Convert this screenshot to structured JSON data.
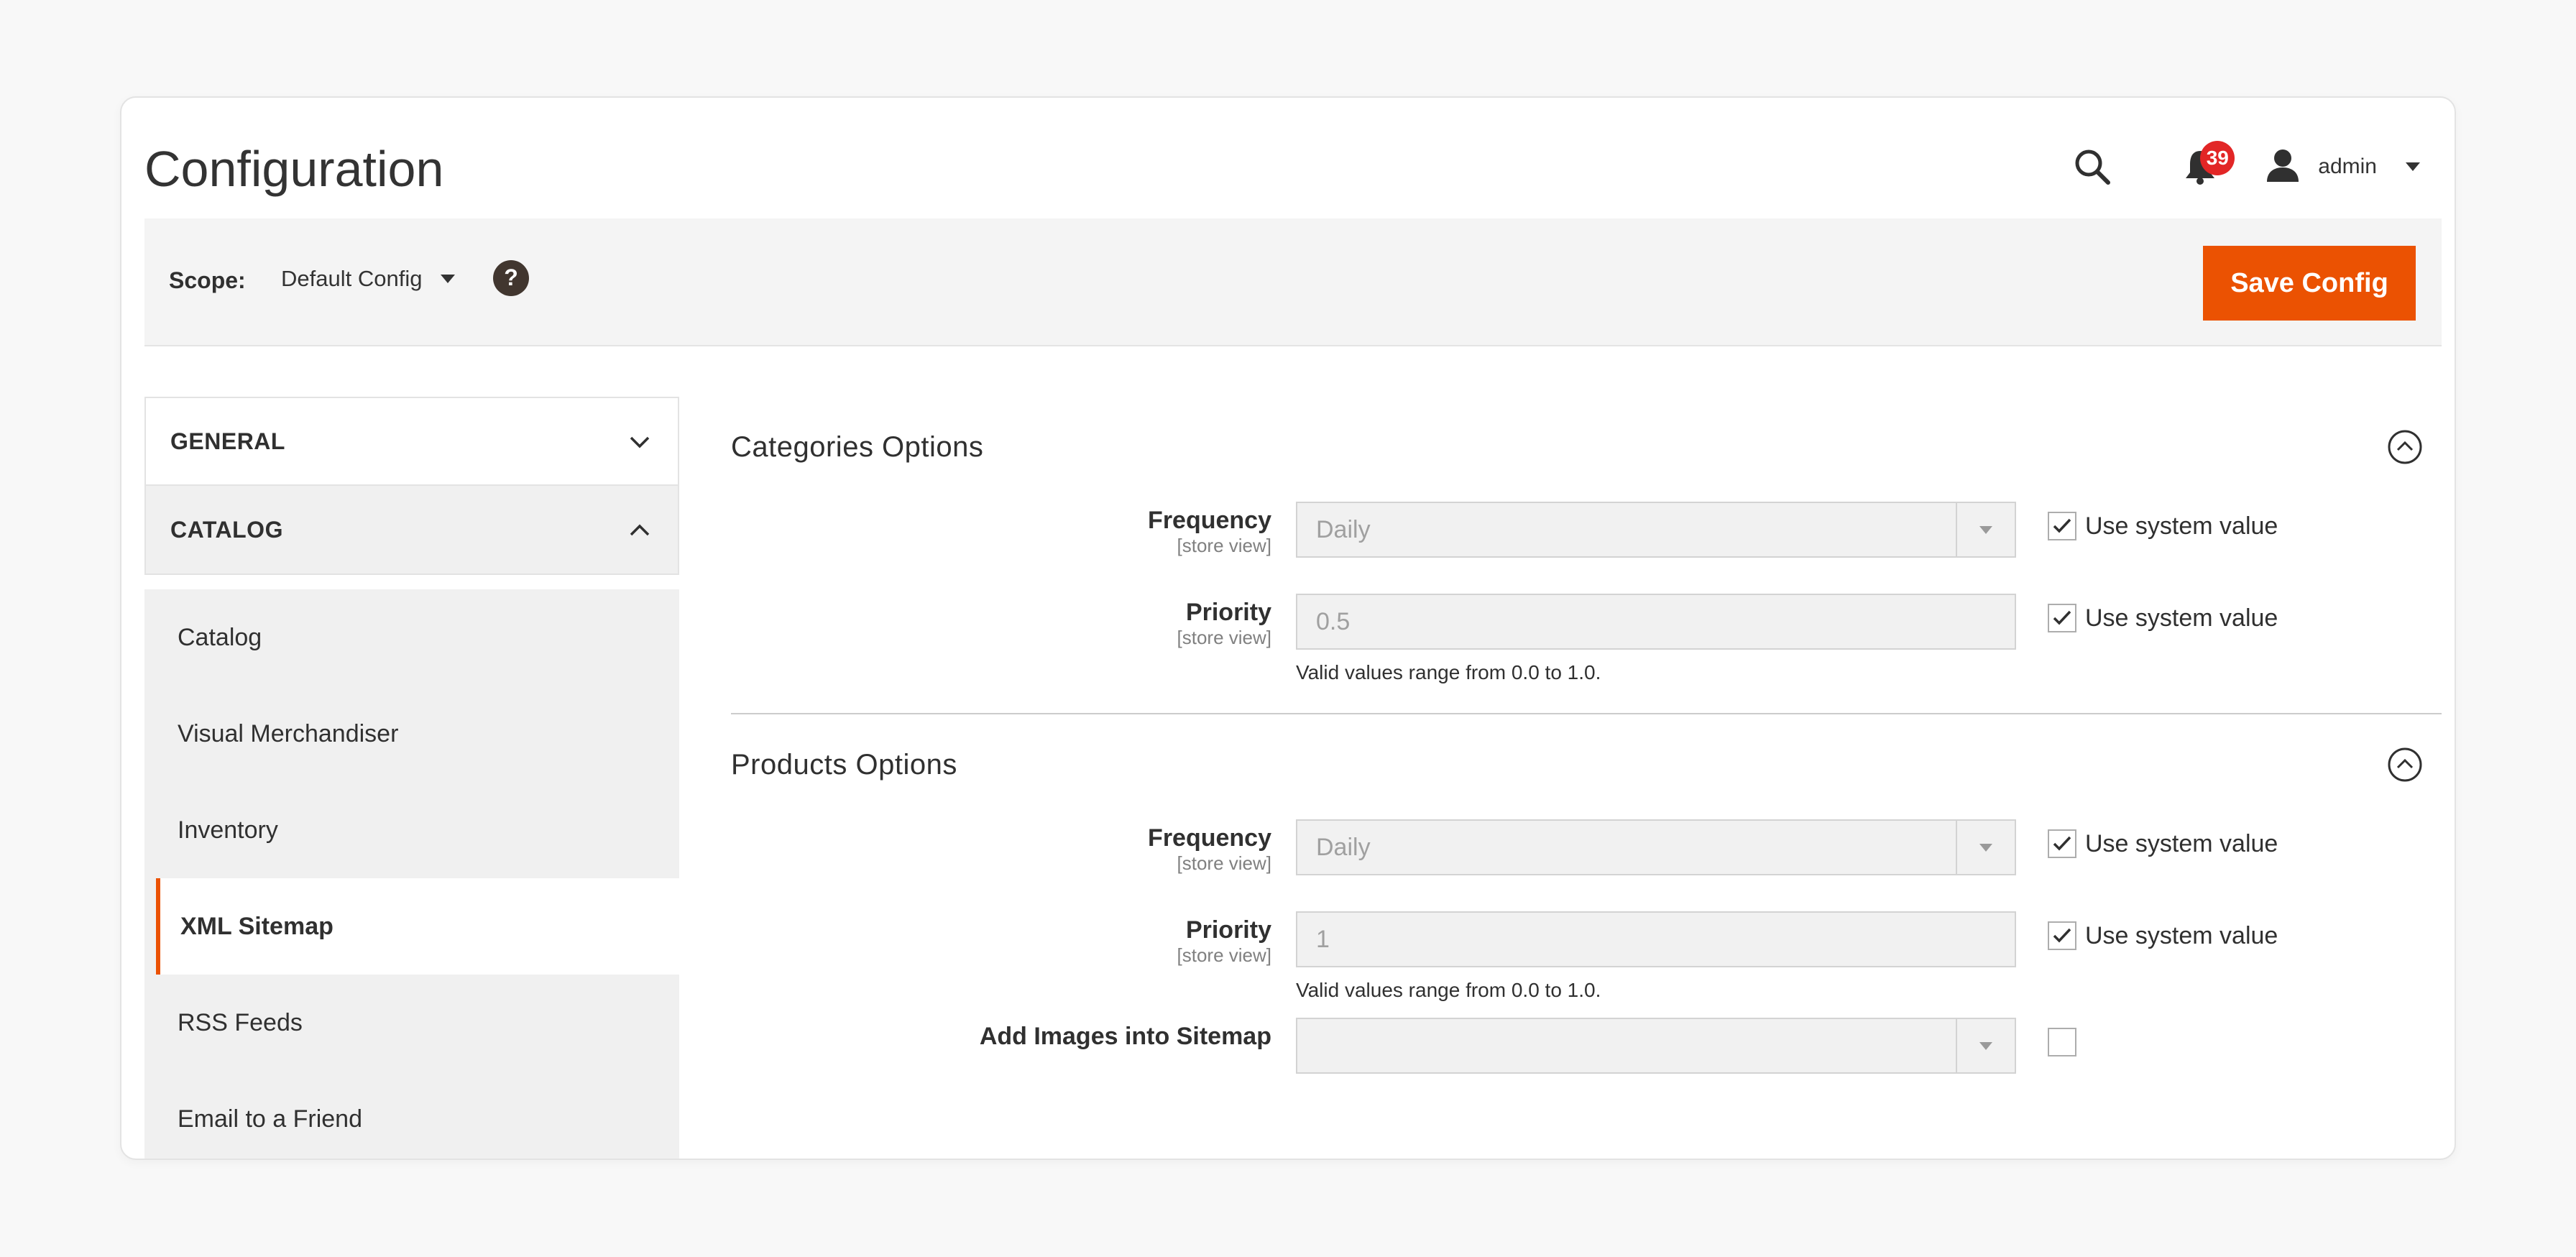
{
  "header": {
    "title": "Configuration",
    "notifications_count": "39",
    "user_name": "admin",
    "icons": {
      "search": "search-icon",
      "notifications": "bell-icon",
      "user": "user-icon",
      "dropdown": "caret-down-icon"
    }
  },
  "scope_bar": {
    "label": "Scope:",
    "value": "Default Config",
    "save_label": "Save Config",
    "help_icon": "question-mark-icon",
    "accent_color": "#eb5202"
  },
  "sidebar": {
    "sections": [
      {
        "label": "GENERAL",
        "expanded": false
      },
      {
        "label": "CATALOG",
        "expanded": true
      }
    ],
    "items": [
      {
        "label": "Catalog",
        "active": false
      },
      {
        "label": "Visual Merchandiser",
        "active": false
      },
      {
        "label": "Inventory",
        "active": false
      },
      {
        "label": "XML Sitemap",
        "active": true
      },
      {
        "label": "RSS Feeds",
        "active": false
      },
      {
        "label": "Email to a Friend",
        "active": false
      }
    ]
  },
  "main": {
    "sections": [
      {
        "title": "Categories Options",
        "fields": [
          {
            "label": "Frequency",
            "scope": "[store view]",
            "value": "Daily",
            "type": "select",
            "use_system_label": "Use system value",
            "use_system": true
          },
          {
            "label": "Priority",
            "scope": "[store view]",
            "value": "0.5",
            "type": "text",
            "note": "Valid values range from 0.0 to 1.0.",
            "use_system_label": "Use system value",
            "use_system": true
          }
        ]
      },
      {
        "title": "Products Options",
        "fields": [
          {
            "label": "Frequency",
            "scope": "[store view]",
            "value": "Daily",
            "type": "select",
            "use_system_label": "Use system value",
            "use_system": true
          },
          {
            "label": "Priority",
            "scope": "[store view]",
            "value": "1",
            "type": "text",
            "note": "Valid values range from 0.0 to 1.0.",
            "use_system_label": "Use system value",
            "use_system": true
          },
          {
            "label": "Add Images into Sitemap",
            "scope": "",
            "value": "",
            "type": "select",
            "use_system_label": "",
            "use_system": false
          }
        ]
      }
    ]
  }
}
